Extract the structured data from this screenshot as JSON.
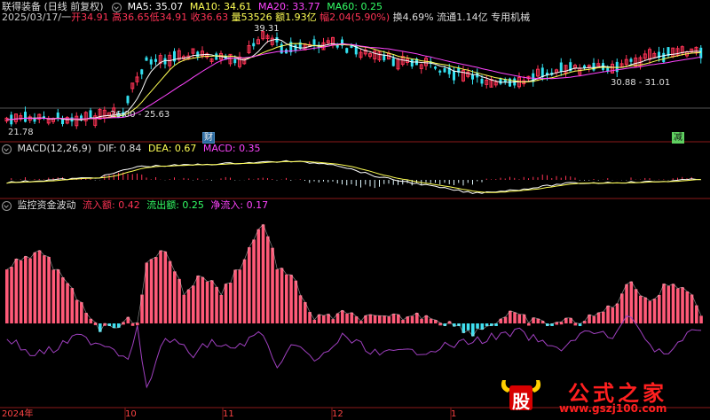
{
  "header": {
    "stock_name": "联得装备",
    "period": "(日线 前复权)",
    "ma5": "MA5: 35.07",
    "ma10": "MA10: 34.61",
    "ma20": "MA20: 33.77",
    "ma60": "MA60: 0.25"
  },
  "quote": {
    "date": "2025/03/17/一",
    "open": "开34.91",
    "high": "高36.65",
    "low": "低34.91",
    "close": "收36.63",
    "volume": "量53526",
    "amount": "额1.93亿",
    "change": "幅2.04(5.90%)",
    "turnover": "换4.69%",
    "float_cap": "流通1.14亿",
    "industry": "专用机械"
  },
  "annotations": {
    "peak": "39.31",
    "low_left": "21.78",
    "range_left": "26.00 - 25.63",
    "range_right": "30.88 - 31.01",
    "badge_cai": "财",
    "badge_jian": "减"
  },
  "macd": {
    "title": "MACD(12,26,9)",
    "dif": "DIF: 0.84",
    "dea": "DEA: 0.67",
    "macd": "MACD: 0.35"
  },
  "monitor": {
    "title": "监控资金波动",
    "inflow": "流入额: 0.42",
    "outflow": "流出额: 0.25",
    "net": "净流入: 0.17"
  },
  "xaxis": [
    "2024年",
    "10",
    "11",
    "12",
    "1"
  ],
  "watermark": {
    "logo_char": "股",
    "brand": "公式之家",
    "url": "www.gszj100.com"
  },
  "colors": {
    "up": "#ff3355",
    "down": "#33e0f0",
    "ma5": "#ffffff",
    "ma10": "#ffff55",
    "ma20": "#ff44ff",
    "ma60": "#33ff66",
    "grid": "#8b1a1a",
    "inflow_bar": "#ff5a78",
    "outflow_bar": "#3fe0f0",
    "net_line": "#a040c0"
  }
}
